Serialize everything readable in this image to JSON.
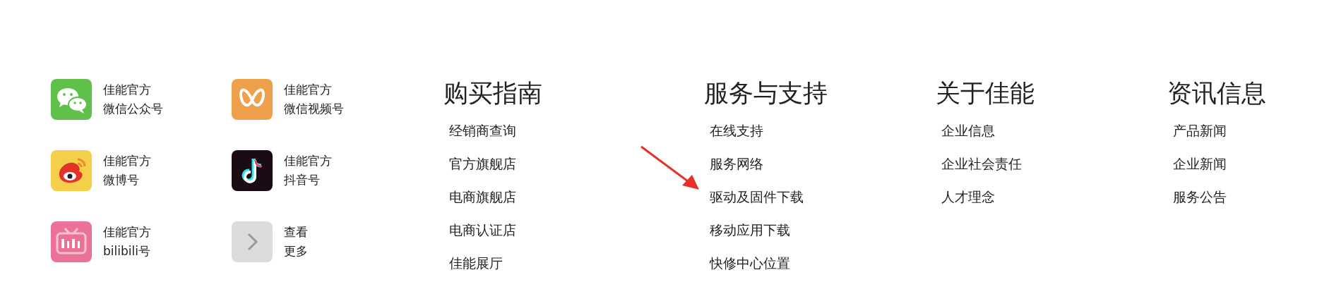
{
  "social": [
    {
      "kind": "chat",
      "lines": [
        "佳能官方",
        "微信公众号"
      ]
    },
    {
      "kind": "butterfly",
      "lines": [
        "佳能官方",
        "微信视频号"
      ]
    },
    {
      "kind": "eye",
      "lines": [
        "佳能官方",
        "微博号"
      ]
    },
    {
      "kind": "note",
      "lines": [
        "佳能官方",
        "抖音号"
      ]
    },
    {
      "kind": "tv",
      "lines": [
        "佳能官方",
        "bilibili号"
      ]
    },
    {
      "kind": "more",
      "lines": [
        "查看",
        "更多"
      ]
    }
  ],
  "columns": [
    {
      "title": "购买指南",
      "items": [
        "经销商查询",
        "官方旗舰店",
        "电商旗舰店",
        "电商认证店",
        "佳能展厅"
      ]
    },
    {
      "title": "服务与支持",
      "items": [
        "在线支持",
        "服务网络",
        "驱动及固件下载",
        "移动应用下载",
        "快修中心位置"
      ]
    },
    {
      "title": "关于佳能",
      "items": [
        "企业信息",
        "企业社会责任",
        "人才理念"
      ]
    },
    {
      "title": "资讯信息",
      "items": [
        "产品新闻",
        "企业新闻",
        "服务公告"
      ]
    }
  ]
}
